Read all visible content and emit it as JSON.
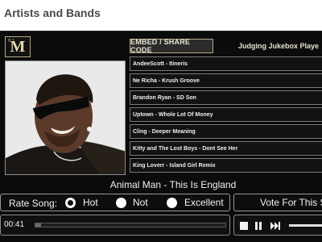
{
  "page": {
    "title": "Artists and Bands"
  },
  "player": {
    "embed_label": "EMBED / SHARE CODE",
    "name": "Judging Jukebox Playe",
    "tracks": [
      "AndeeScott - Itineris",
      "Ne Richa - Krush Groove",
      "Brandon Ryan - SD Son",
      "Uptown - Whole Lot Of Money",
      "Cling - Deeper Meaning",
      "Kitty and The Lost Boys - Dont See Her",
      "King Loverr - Island Girl Remix"
    ],
    "now_playing": "Animal Man - This Is England",
    "rate": {
      "label": "Rate Song:",
      "options": [
        "Hot",
        "Not",
        "Excellent"
      ],
      "selected": "Hot"
    },
    "vote_label": "Vote For This S",
    "time": "00:41",
    "progress": 0.03
  },
  "colors": {
    "player_bg": "#0b0b0b",
    "accent_border": "#b8a98a",
    "text": "#f2f2f2"
  },
  "icons": {
    "logo": "mp3-m-logo",
    "stop": "stop-icon",
    "pause": "pause-icon",
    "next": "next-icon"
  }
}
